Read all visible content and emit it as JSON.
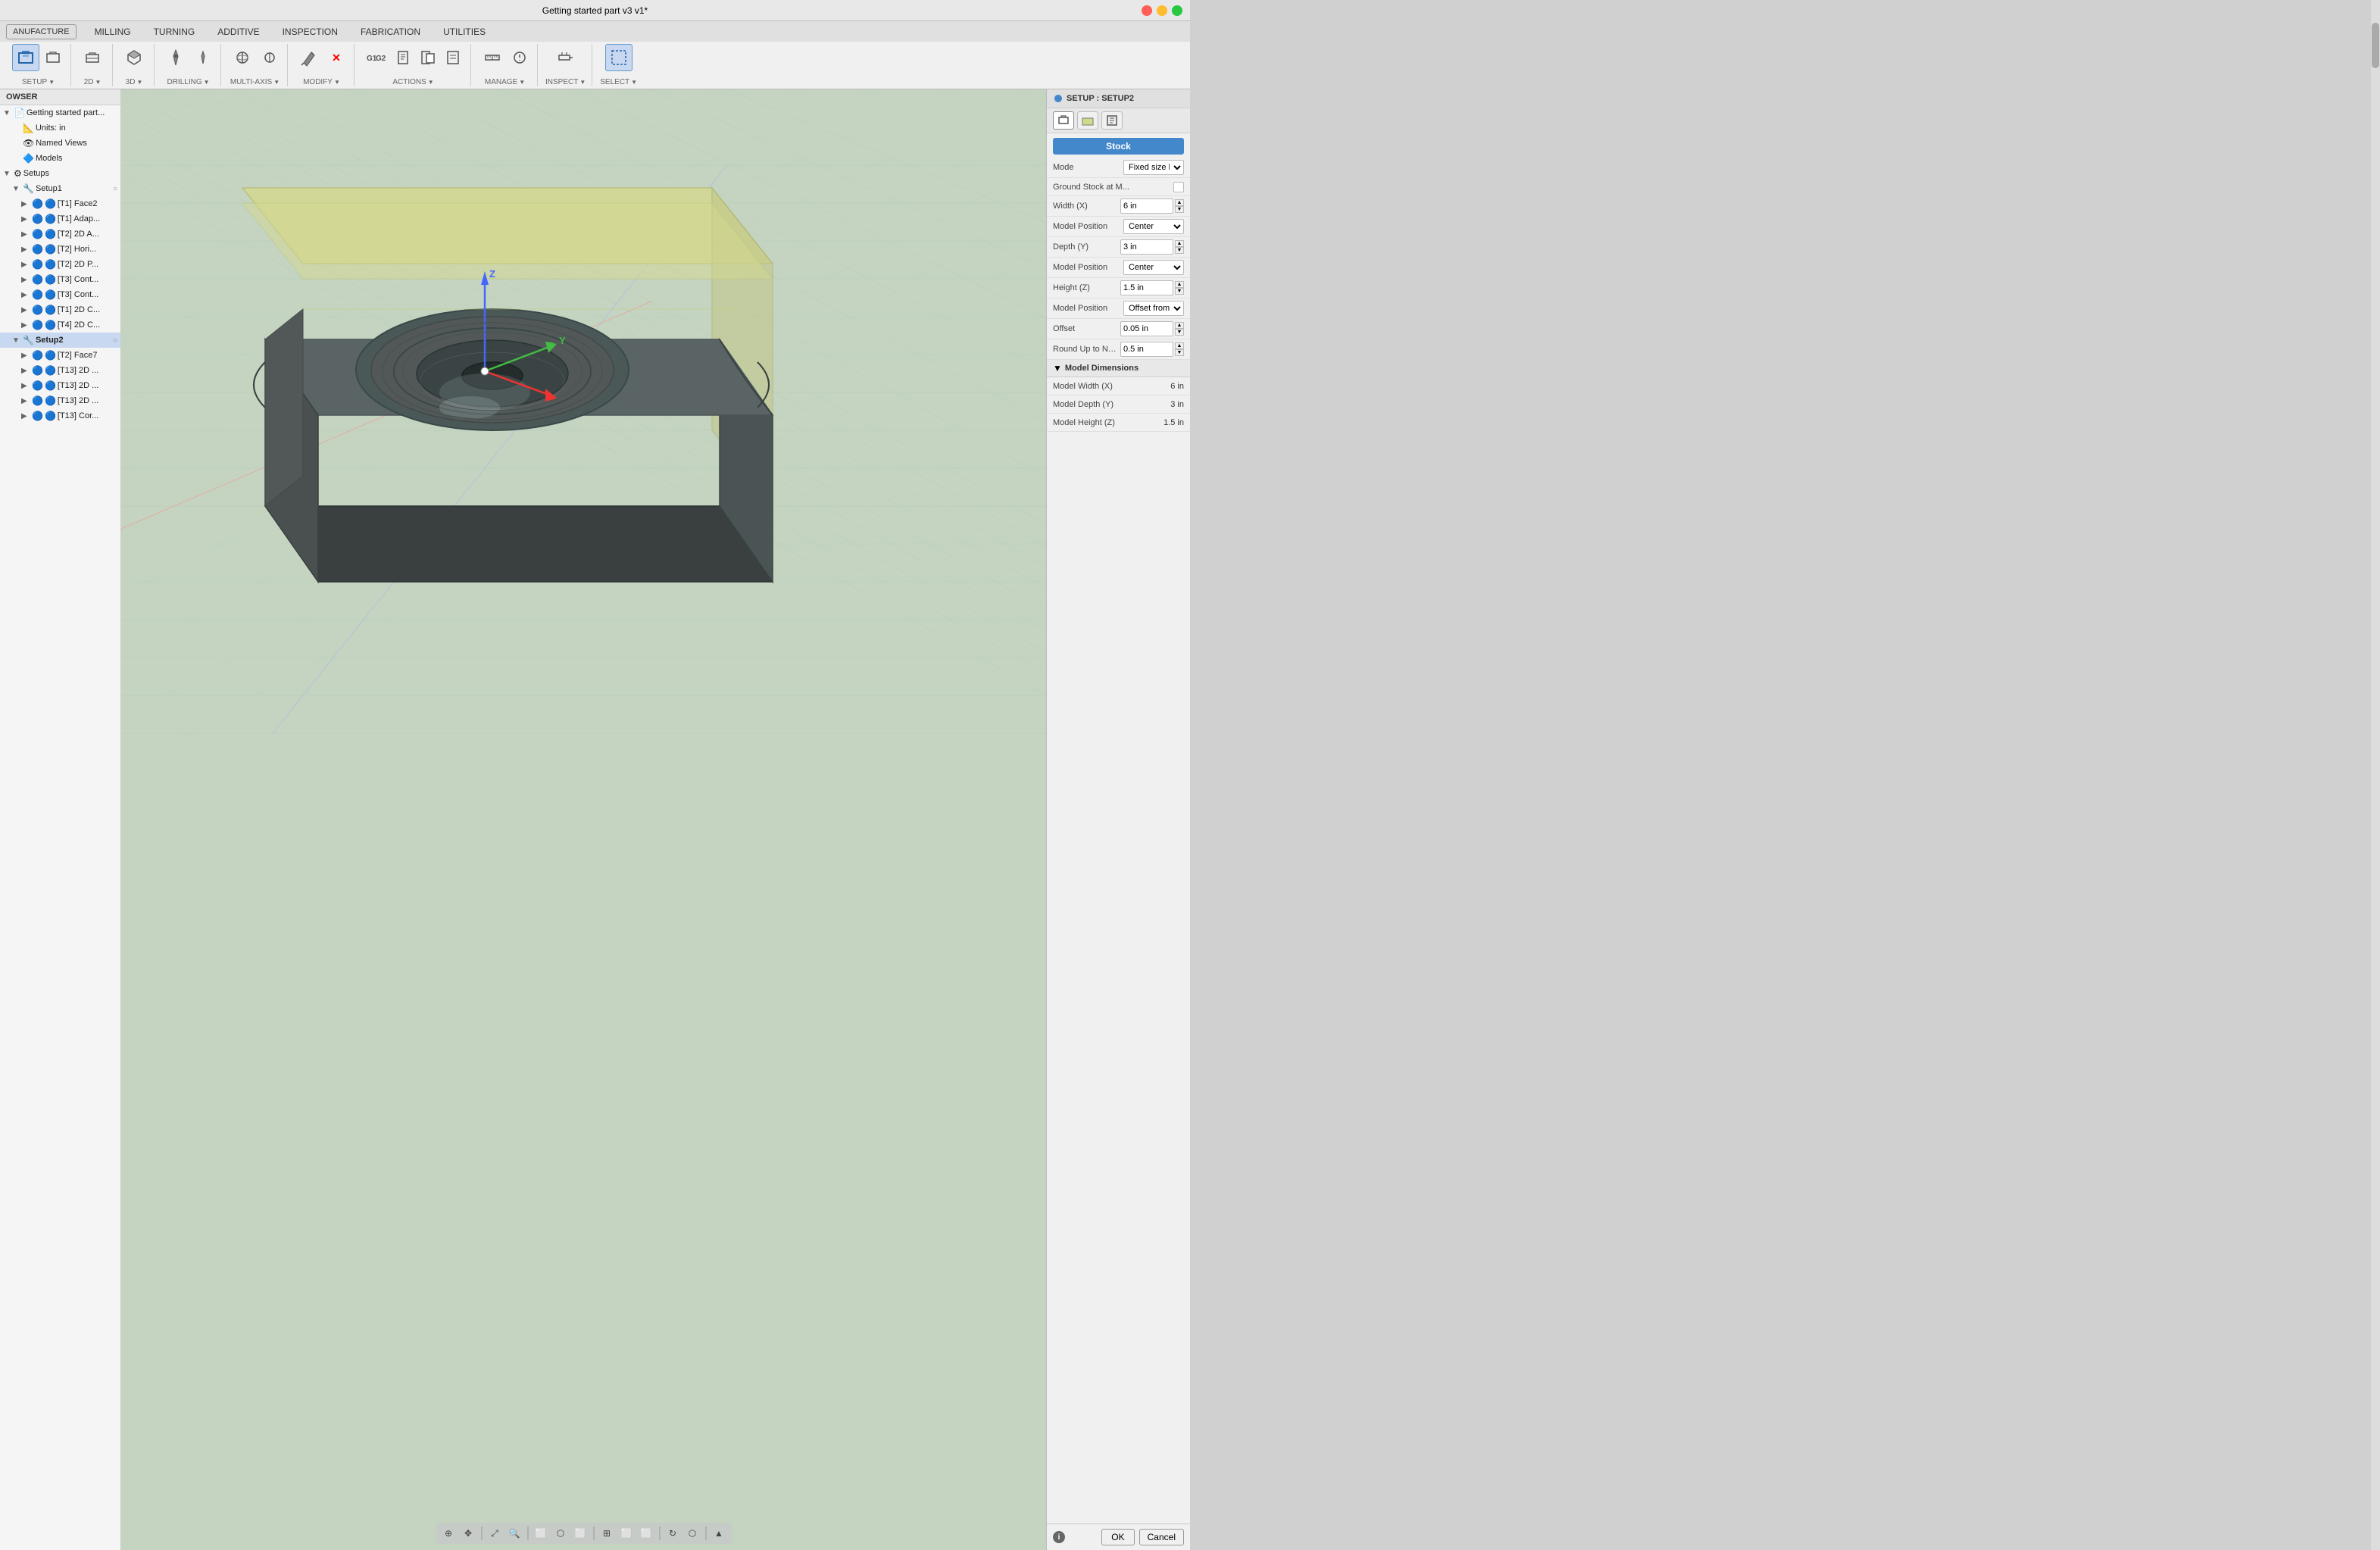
{
  "titlebar": {
    "title": "Getting started part v3 v1*"
  },
  "tabs": {
    "items": [
      "MILLING",
      "TURNING",
      "ADDITIVE",
      "INSPECTION",
      "FABRICATION",
      "UTILITIES"
    ],
    "active": "MILLING"
  },
  "manufacture_label": "ANUFACTURE",
  "tool_groups": [
    {
      "label": "SETUP",
      "has_arrow": true
    },
    {
      "label": "2D",
      "has_arrow": true
    },
    {
      "label": "3D",
      "has_arrow": true
    },
    {
      "label": "DRILLING",
      "has_arrow": true
    },
    {
      "label": "MULTI-AXIS",
      "has_arrow": true
    },
    {
      "label": "MODIFY",
      "has_arrow": true
    },
    {
      "label": "ACTIONS",
      "has_arrow": true
    },
    {
      "label": "MANAGE",
      "has_arrow": true
    },
    {
      "label": "INSPECT",
      "has_arrow": true
    },
    {
      "label": "SELECT",
      "has_arrow": true
    }
  ],
  "sidebar": {
    "header": "OWSER",
    "items": [
      {
        "label": "Getting started part...",
        "level": 1,
        "icon": "📄",
        "expandable": true,
        "expanded": true
      },
      {
        "label": "Units: in",
        "level": 2,
        "icon": "📏",
        "expandable": false
      },
      {
        "label": "Named Views",
        "level": 2,
        "icon": "👁",
        "expandable": false
      },
      {
        "label": "Models",
        "level": 2,
        "icon": "🔷",
        "expandable": false
      },
      {
        "label": "Setups",
        "level": 1,
        "icon": "⚙",
        "expandable": true,
        "expanded": true
      },
      {
        "label": "Setup1",
        "level": 2,
        "icon": "🔧",
        "expandable": true,
        "expanded": true,
        "badge": "○"
      },
      {
        "label": "[T1] Face2",
        "level": 3,
        "icon": "🔵",
        "expandable": true
      },
      {
        "label": "[T1] Adap...",
        "level": 3,
        "icon": "🔵",
        "expandable": true
      },
      {
        "label": "[T2] 2D A...",
        "level": 3,
        "icon": "🔵",
        "expandable": true
      },
      {
        "label": "[T2] Hori...",
        "level": 3,
        "icon": "🔵",
        "expandable": true
      },
      {
        "label": "[T2] 2D P...",
        "level": 3,
        "icon": "🔵",
        "expandable": true
      },
      {
        "label": "[T3] Cont...",
        "level": 3,
        "icon": "🔵",
        "expandable": true
      },
      {
        "label": "[T3] Cont...",
        "level": 3,
        "icon": "🔵",
        "expandable": true
      },
      {
        "label": "[T1] 2D C...",
        "level": 3,
        "icon": "🔵",
        "expandable": true
      },
      {
        "label": "[T4] 2D C...",
        "level": 3,
        "icon": "🔵",
        "expandable": true
      },
      {
        "label": "Setup2",
        "level": 2,
        "icon": "🔧",
        "expandable": true,
        "expanded": true,
        "active": true,
        "badge": "○"
      },
      {
        "label": "[T2] Face7",
        "level": 3,
        "icon": "🔵",
        "expandable": true
      },
      {
        "label": "[T13] 2D ...",
        "level": 3,
        "icon": "🔵",
        "expandable": true
      },
      {
        "label": "[T13] 2D ...",
        "level": 3,
        "icon": "🔵",
        "expandable": true
      },
      {
        "label": "[T13] 2D ...",
        "level": 3,
        "icon": "🔵",
        "expandable": true
      },
      {
        "label": "[T13] Cor...",
        "level": 3,
        "icon": "🔵",
        "expandable": true
      }
    ]
  },
  "right_panel": {
    "header": "SETUP : SETUP2",
    "tabs": [
      "doc-icon",
      "grid-icon",
      "table-icon"
    ],
    "stock_button": "Stock",
    "mode_label": "Mode",
    "mode_value": "Fixed size l...",
    "ground_stock_label": "Ground Stock at M...",
    "width_label": "Width (X)",
    "width_value": "6 in",
    "width_pos_label": "Model Position",
    "width_pos_value": "Center",
    "depth_label": "Depth (Y)",
    "depth_value": "3 in",
    "depth_pos_label": "Model Position",
    "depth_pos_value": "Center",
    "height_label": "Height (Z)",
    "height_value": "1.5 in",
    "height_pos_label": "Model Position",
    "height_pos_value": "Offset from...",
    "offset_label": "Offset",
    "offset_value": "0.05 in",
    "round_label": "Round Up to Neare...",
    "round_value": "0.5 in",
    "model_dimensions_label": "Model Dimensions",
    "model_width_label": "Model Width (X)",
    "model_width_value": "6 in",
    "model_depth_label": "Model Depth (Y)",
    "model_depth_value": "3 in",
    "model_height_label": "Model Height (Z)",
    "model_height_value": "1.5 in",
    "ok_label": "OK",
    "cancel_label": "Cancel"
  },
  "bottom_toolbar": {
    "buttons": [
      "⊕",
      "↔",
      "🔍",
      "🔍",
      "⬜",
      "⬜",
      "⬡",
      "⬜",
      "⬜",
      "↩",
      "⬜",
      "▲"
    ]
  },
  "fixed_size_label": "Fixed size"
}
